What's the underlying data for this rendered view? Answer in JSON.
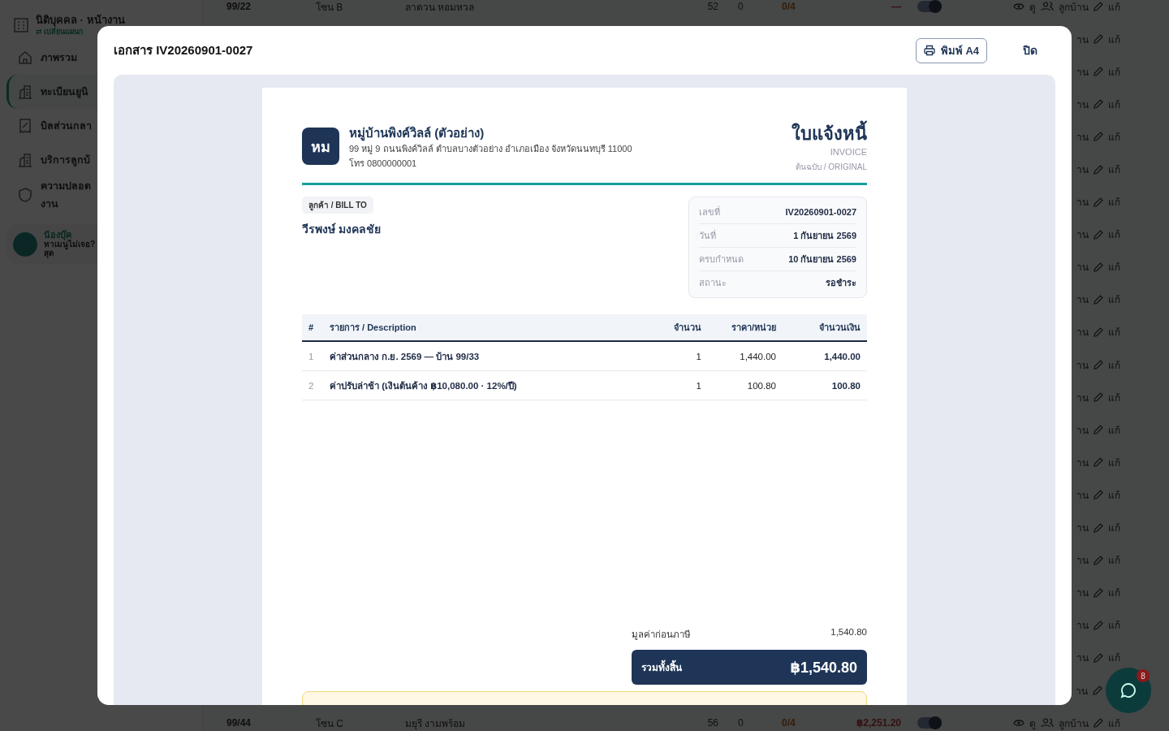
{
  "sidebar": {
    "org_title": "นิติบุคคล · หน้างาน",
    "org_switch": "⇄ เปลี่ยนแผนก",
    "items": [
      {
        "label": "ภาพรวม",
        "selected": false
      },
      {
        "label": "ทะเบียนยูนิ",
        "selected": true
      },
      {
        "label": "บิลส่วนกลา",
        "selected": false
      },
      {
        "label": "บริการลูกบ้",
        "selected": false
      },
      {
        "label": "ความปลอด\nงาน",
        "selected": false
      }
    ],
    "user": {
      "name": "น้องบุ๊ค",
      "hint": "หาเมนูไม่เจอ?",
      "hint_2": "สุด"
    }
  },
  "units_table": {
    "rows": [
      {
        "kind": "full",
        "unit": "99/22",
        "zone": "โซน B",
        "name": "ลาดวน หอมหวล",
        "count": "52",
        "col_5": "0",
        "ratio": "0/4",
        "amount": "—",
        "on": true,
        "view": "ดู",
        "residents": "ลูกบ้าน",
        "edit": "แก้"
      },
      {
        "kind": "tail",
        "residents": "าน",
        "edit": "แก้"
      },
      {
        "kind": "tail",
        "residents": "าน",
        "edit": "แก้"
      },
      {
        "kind": "tail",
        "residents": "าน",
        "edit": "แก้"
      },
      {
        "kind": "tail",
        "residents": "าน",
        "edit": "แก้"
      },
      {
        "kind": "tail",
        "residents": "าน",
        "edit": "แก้"
      },
      {
        "kind": "tail",
        "residents": "าน",
        "edit": "แก้"
      },
      {
        "kind": "tail",
        "residents": "าน",
        "edit": "แก้"
      },
      {
        "kind": "tail",
        "residents": "าน",
        "edit": "แก้"
      },
      {
        "kind": "tail",
        "residents": "าน",
        "edit": "แก้"
      },
      {
        "kind": "tail",
        "residents": "าน",
        "edit": "แก้"
      },
      {
        "kind": "tail",
        "residents": "าน",
        "edit": "แก้"
      },
      {
        "kind": "tail",
        "residents": "าน",
        "edit": "แก้"
      },
      {
        "kind": "tail",
        "residents": "าน",
        "edit": "แก้"
      },
      {
        "kind": "tail",
        "residents": "าน",
        "edit": "แก้"
      },
      {
        "kind": "tail",
        "residents": "าน",
        "edit": "แก้"
      },
      {
        "kind": "tail",
        "residents": "าน",
        "edit": "แก้"
      },
      {
        "kind": "tail",
        "residents": "าน",
        "edit": "แก้"
      },
      {
        "kind": "tail",
        "residents": "าน",
        "edit": "แก้"
      },
      {
        "kind": "tail",
        "residents": "าน",
        "edit": "แก้"
      },
      {
        "kind": "tail",
        "residents": "าน",
        "edit": "แก้"
      },
      {
        "kind": "tail",
        "residents": "าน"
      },
      {
        "kind": "full",
        "unit": "99/44",
        "zone": "โซน C",
        "name": "มยุรี งามพร้อม",
        "count": "56",
        "col_5": "0",
        "ratio": "0/4",
        "amount": "฿2,251.20",
        "on": true,
        "view": "ดู",
        "residents": "ลูกบ้าน",
        "edit": "แก้"
      }
    ]
  },
  "chat": {
    "badge": "8"
  },
  "modal": {
    "title": "เอกสาร IV20260901-0027",
    "print_button": "พิมพ์ A4",
    "close_button": "ปิด",
    "document": {
      "logo": "หม",
      "org_name": "หมู่บ้านพิงค์วิลล์ (ตัวอย่าง)",
      "address": "99 หมู่ 9 ถนนพิงค์วิลล์ ตำบลบางตัวอย่าง อำเภอเมือง จังหวัดนนทบุรี 11000",
      "phone": "โทร 0800000001",
      "doc_title": "ใบแจ้งหนี้",
      "doc_title_en": "INVOICE",
      "copy_label": "ต้นฉบับ / ORIGINAL",
      "bill_to_label": "ลูกค้า / BILL TO",
      "customer": "วีรพงษ์ มงคลชัย",
      "meta": [
        {
          "label": "เลขที่",
          "value": "IV20260901-0027"
        },
        {
          "label": "วันที่",
          "value": "1 กันยายน 2569"
        },
        {
          "label": "ครบกำหนด",
          "value": "10 กันยายน 2569"
        },
        {
          "label": "สถานะ",
          "value": "รอชำระ"
        }
      ],
      "columns": [
        "#",
        "รายการ / Description",
        "จำนวน",
        "ราคา/หน่วย",
        "จำนวนเงิน"
      ],
      "items": [
        {
          "no": "1",
          "description": "ค่าส่วนกลาง ก.ย. 2569 — บ้าน 99/33",
          "qty": "1",
          "unit_price": "1,440.00",
          "amount": "1,440.00"
        },
        {
          "no": "2",
          "description": "ค่าปรับล่าช้า (เงินต้นค้าง ฿10,080.00 · 12%/ปี)",
          "qty": "1",
          "unit_price": "100.80",
          "amount": "100.80"
        }
      ],
      "subtotal_label": "มูลค่าก่อนภาษี",
      "subtotal": "1,540.80",
      "total_label": "รวมทั้งสิ้น",
      "total": "฿1,540.80"
    }
  }
}
